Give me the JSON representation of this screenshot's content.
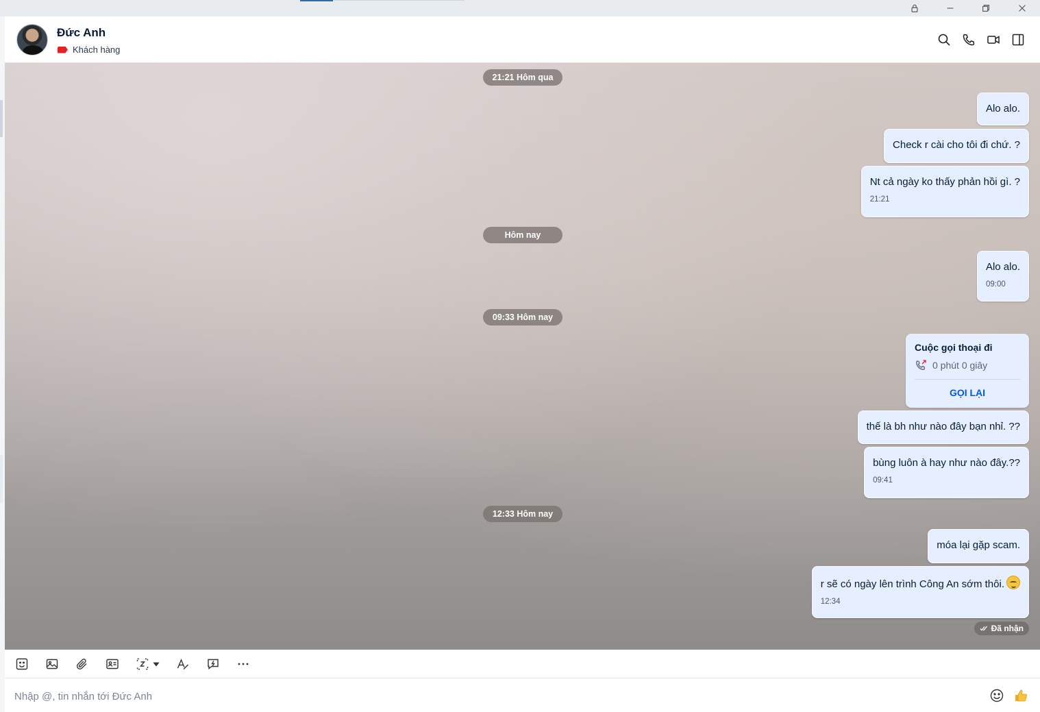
{
  "header": {
    "contact_name": "Đức Anh",
    "tag_label": "Khách hàng",
    "tag_color": "#e02424",
    "icons": [
      "search-icon",
      "phone-icon",
      "video-icon",
      "panel-icon"
    ]
  },
  "chat": {
    "separators": [
      "21:21 Hôm qua",
      "Hôm nay",
      "09:33 Hôm nay",
      "12:33 Hôm nay"
    ],
    "messages": [
      {
        "text": "Alo alo.",
        "time": ""
      },
      {
        "text": "Check r cài cho tôi đi chứ. ?",
        "time": ""
      },
      {
        "text": "Nt cả ngày ko thấy phản hồi gì. ?",
        "time": "21:21"
      },
      {
        "text": "Alo alo.",
        "time": "09:00"
      },
      {
        "text": "thế là bh như nào đây bạn nhỉ. ??",
        "time": ""
      },
      {
        "text": "bùng luôn à hay như nào đây.??",
        "time": "09:41"
      },
      {
        "text": "móa lại gặp scam.",
        "time": ""
      },
      {
        "text": "r sẽ có ngày lên trình Công An sớm thôi.",
        "time": "12:34"
      }
    ],
    "call_card": {
      "title": "Cuộc gọi thoại đi",
      "duration": "0 phút 0 giây",
      "action": "GỌI LẠI"
    },
    "status": "Đã nhận",
    "bubble_color": "#e5efff"
  },
  "composer": {
    "placeholder": "Nhập @, tin nhắn tới Đức Anh",
    "value": ""
  },
  "accent": "#005ae0"
}
